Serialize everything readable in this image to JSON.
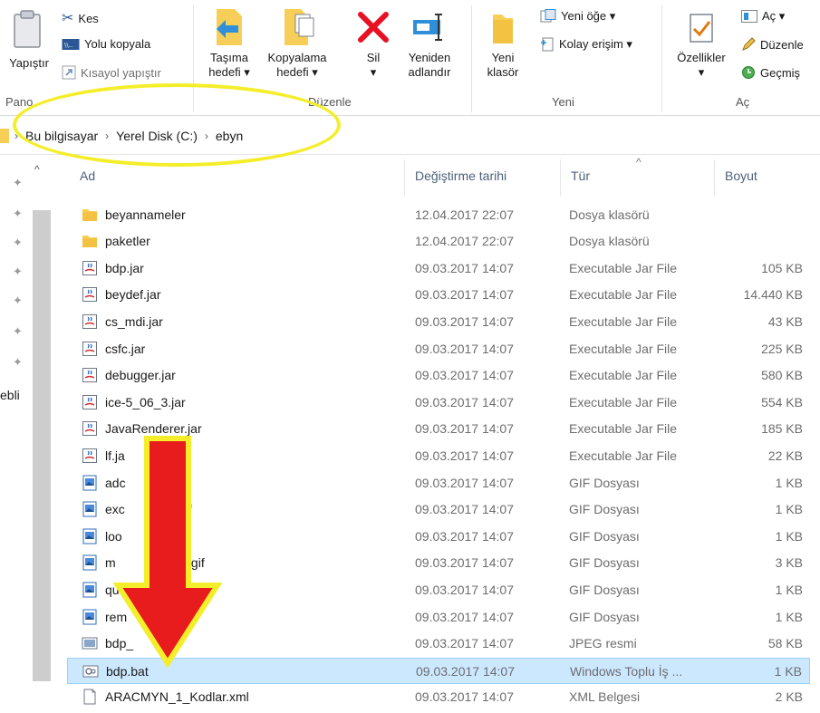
{
  "ribbon": {
    "pano": {
      "paste_label": "Yapıştır",
      "cut_label": "Kes",
      "copy_path_label": "Yolu kopyala",
      "paste_shortcut_label": "Kısayol yapıştır",
      "group_label": "Pano"
    },
    "duzenle": {
      "move_to_label_1": "Taşıma",
      "move_to_label_2": "hedefi ▾",
      "copy_to_label_1": "Kopyalama",
      "copy_to_label_2": "hedefi ▾",
      "delete_label_1": "Sil",
      "delete_label_2": "▾",
      "rename_label_1": "Yeniden",
      "rename_label_2": "adlandır",
      "group_label": "Düzenle"
    },
    "yeni": {
      "new_folder_label_1": "Yeni",
      "new_folder_label_2": "klasör",
      "new_item_label": "Yeni öğe ▾",
      "easy_access_label": "Kolay erişim ▾",
      "group_label": "Yeni"
    },
    "ac": {
      "properties_label_1": "Özellikler",
      "properties_label_2": "▾",
      "open_label": "Aç ▾",
      "edit_label": "Düzenle",
      "history_label": "Geçmiş",
      "group_label": "Aç"
    }
  },
  "address": {
    "crumbs": [
      "Bu bilgisayar",
      "Yerel Disk (C:)",
      "ebyn"
    ]
  },
  "nav": {
    "partial_label": "ebli"
  },
  "columns": {
    "name": "Ad",
    "date": "Değiştirme tarihi",
    "type": "Tür",
    "size": "Boyut"
  },
  "files": [
    {
      "name": "beyannameler",
      "date": "12.04.2017 22:07",
      "type": "Dosya klasörü",
      "size": "",
      "icon": "folder-icon"
    },
    {
      "name": "paketler",
      "date": "12.04.2017 22:07",
      "type": "Dosya klasörü",
      "size": "",
      "icon": "folder-icon"
    },
    {
      "name": "bdp.jar",
      "date": "09.03.2017 14:07",
      "type": "Executable Jar File",
      "size": "105 KB",
      "icon": "jar-icon"
    },
    {
      "name": "beydef.jar",
      "date": "09.03.2017 14:07",
      "type": "Executable Jar File",
      "size": "14.440 KB",
      "icon": "jar-icon"
    },
    {
      "name": "cs_mdi.jar",
      "date": "09.03.2017 14:07",
      "type": "Executable Jar File",
      "size": "43 KB",
      "icon": "jar-icon"
    },
    {
      "name": "csfc.jar",
      "date": "09.03.2017 14:07",
      "type": "Executable Jar File",
      "size": "225 KB",
      "icon": "jar-icon"
    },
    {
      "name": "debugger.jar",
      "date": "09.03.2017 14:07",
      "type": "Executable Jar File",
      "size": "580 KB",
      "icon": "jar-icon"
    },
    {
      "name": "ice-5_06_3.jar",
      "date": "09.03.2017 14:07",
      "type": "Executable Jar File",
      "size": "554 KB",
      "icon": "jar-icon"
    },
    {
      "name": "JavaRenderer.jar",
      "date": "09.03.2017 14:07",
      "type": "Executable Jar File",
      "size": "185 KB",
      "icon": "jar-icon"
    },
    {
      "name": "lf.ja",
      "date": "09.03.2017 14:07",
      "type": "Executable Jar File",
      "size": "22 KB",
      "icon": "jar-icon"
    },
    {
      "name": "adc",
      "date": "09.03.2017 14:07",
      "type": "GIF Dosyası",
      "size": "1 KB",
      "icon": "image-icon"
    },
    {
      "name": "exc          ort.gif",
      "date": "09.03.2017 14:07",
      "type": "GIF Dosyası",
      "size": "1 KB",
      "icon": "image-icon"
    },
    {
      "name": "loo          n.gif",
      "date": "09.03.2017 14:07",
      "type": "GIF Dosyası",
      "size": "1 KB",
      "icon": "image-icon"
    },
    {
      "name": "m            anligi.gif",
      "date": "09.03.2017 14:07",
      "type": "GIF Dosyası",
      "size": "3 KB",
      "icon": "image-icon"
    },
    {
      "name": "qu           gif",
      "date": "09.03.2017 14:07",
      "type": "GIF Dosyası",
      "size": "1 KB",
      "icon": "image-icon"
    },
    {
      "name": "rem          gif",
      "date": "09.03.2017 14:07",
      "type": "GIF Dosyası",
      "size": "1 KB",
      "icon": "image-icon"
    },
    {
      "name": "bdp_      .jpg",
      "date": "09.03.2017 14:07",
      "type": "JPEG resmi",
      "size": "58 KB",
      "icon": "jpeg-icon"
    },
    {
      "name": "bdp.bat",
      "date": "09.03.2017 14:07",
      "type": "Windows Toplu İş ...",
      "size": "1 KB",
      "icon": "batch-file-icon",
      "selected": true
    },
    {
      "name": "ARACMYN_1_Kodlar.xml",
      "date": "09.03.2017 14:07",
      "type": "XML Belgesi",
      "size": "2 KB",
      "icon": "xml-file-icon"
    }
  ],
  "colors": {
    "selection_bg": "#cce8ff",
    "selection_border": "#99d1ff",
    "annotation_yellow": "#f4ee2a",
    "annotation_red": "#e81c1c",
    "folder": "#f7cf58",
    "delete_red": "#e81123"
  }
}
